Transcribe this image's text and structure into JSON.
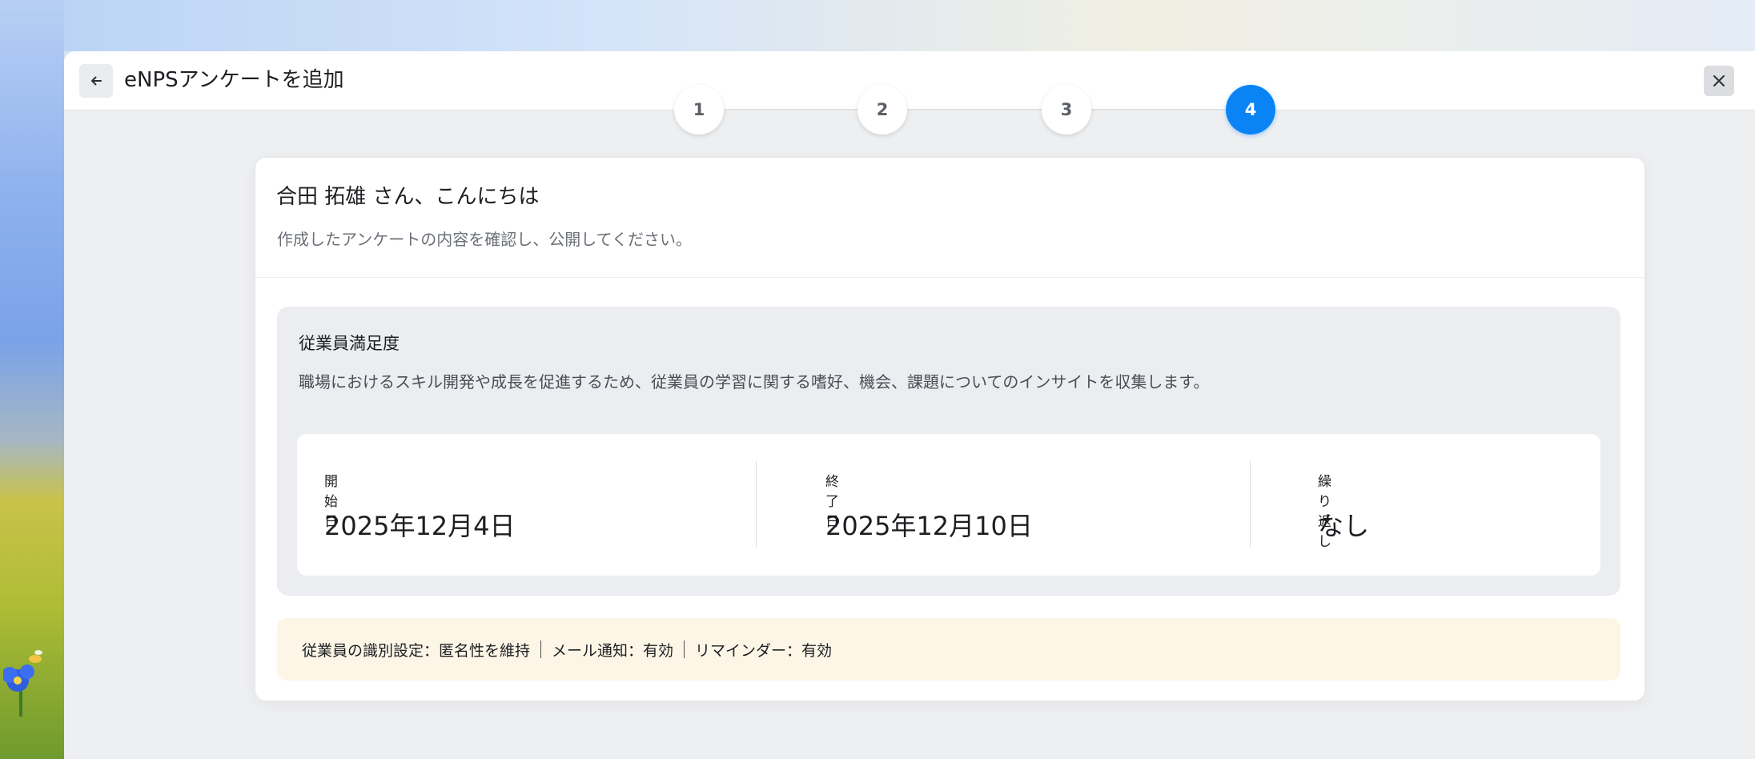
{
  "header": {
    "title": "eNPSアンケートを追加"
  },
  "stepper": {
    "steps": [
      "1",
      "2",
      "3",
      "4"
    ],
    "active_step": 4
  },
  "card": {
    "greeting": "合田 拓雄 さん、こんにちは",
    "subtitle": "作成したアンケートの内容を確認し、公開してください。"
  },
  "survey": {
    "name": "従業員満足度",
    "description": "職場におけるスキル開発や成長を促進するため、従業員の学習に関する嗜好、機会、課題についてのインサイトを収集します。",
    "start_label": "開始日",
    "start_value": "2025年12月4日",
    "end_label": "終了日",
    "end_value": "2025年12月10日",
    "repeat_label": "繰り返し",
    "repeat_value": "なし"
  },
  "settings": {
    "identification": "従業員の識別設定：匿名性を維持",
    "email": "メール通知：有効",
    "reminder": "リマインダー：有効"
  },
  "colors": {
    "accent": "#0a84f5",
    "settings_bg": "#fdf6e6"
  },
  "icons": {
    "back": "arrow-left-icon",
    "close": "close-icon"
  }
}
